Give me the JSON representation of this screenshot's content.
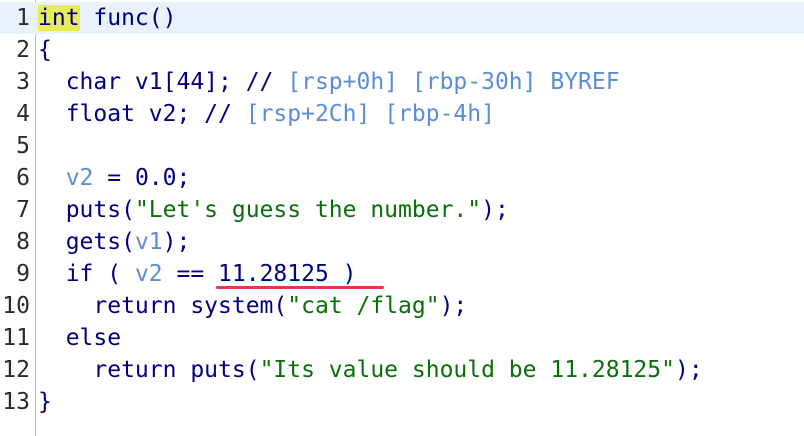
{
  "lines": [
    {
      "n": "1",
      "parts": [
        [
          "kw-hl",
          "int"
        ],
        [
          "kw",
          " func()"
        ]
      ]
    },
    {
      "n": "2",
      "parts": [
        [
          "kw",
          "{"
        ]
      ]
    },
    {
      "n": "3",
      "parts": [
        [
          "kw",
          "  char v1[44]; // "
        ],
        [
          "cmt-ref",
          "[rsp+0h] [rbp-30h]"
        ],
        [
          "kw",
          " "
        ],
        [
          "cmt-ref",
          "BYREF"
        ]
      ]
    },
    {
      "n": "4",
      "parts": [
        [
          "kw",
          "  float v2; // "
        ],
        [
          "cmt-ref",
          "[rsp+2Ch] [rbp-4h]"
        ]
      ]
    },
    {
      "n": "5",
      "parts": []
    },
    {
      "n": "6",
      "parts": [
        [
          "kw",
          "  "
        ],
        [
          "var",
          "v2"
        ],
        [
          "kw",
          " = 0.0;"
        ]
      ]
    },
    {
      "n": "7",
      "parts": [
        [
          "kw",
          "  puts("
        ],
        [
          "str",
          "\"Let's guess the number.\""
        ],
        [
          "kw",
          ");"
        ]
      ]
    },
    {
      "n": "8",
      "parts": [
        [
          "kw",
          "  gets("
        ],
        [
          "var",
          "v1"
        ],
        [
          "kw",
          ");"
        ]
      ]
    },
    {
      "n": "9",
      "parts": [
        [
          "kw",
          "  if ( "
        ],
        [
          "var",
          "v2"
        ],
        [
          "kw",
          " == 11.28125 )"
        ]
      ]
    },
    {
      "n": "10",
      "parts": [
        [
          "kw",
          "    return system("
        ],
        [
          "str",
          "\"cat /flag\""
        ],
        [
          "kw",
          ");"
        ]
      ]
    },
    {
      "n": "11",
      "parts": [
        [
          "kw",
          "  else"
        ]
      ]
    },
    {
      "n": "12",
      "parts": [
        [
          "kw",
          "    return puts("
        ],
        [
          "str",
          "\"Its value should be 11.28125\""
        ],
        [
          "kw",
          ");"
        ]
      ]
    },
    {
      "n": "13",
      "parts": [
        [
          "kw",
          "}"
        ]
      ]
    }
  ],
  "colors": {
    "keyword": "#000080",
    "variable": "#5b8dd6",
    "string": "#0a6e0a",
    "highlight": "#e9ec5a",
    "underline": "#e23a4a"
  }
}
